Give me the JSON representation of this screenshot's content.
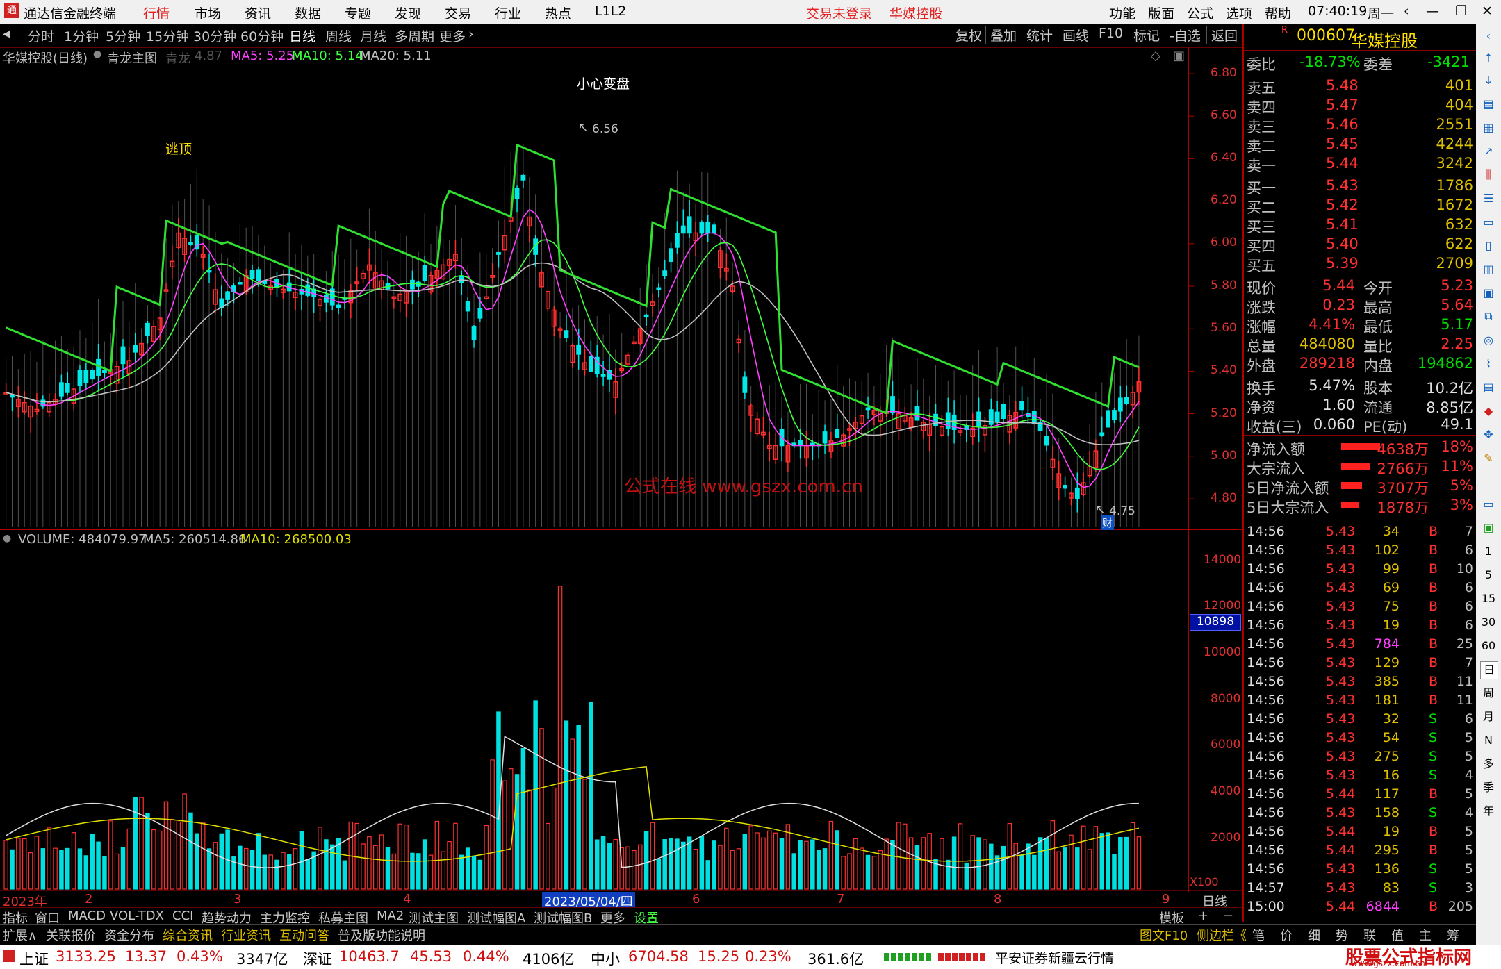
{
  "window": {
    "app_title": "通达信金融终端",
    "menus": [
      "行情",
      "市场",
      "资讯",
      "数据",
      "专题",
      "发现",
      "交易",
      "行业",
      "热点",
      "L1L2"
    ],
    "login_status": "交易未登录",
    "stock_name": "华媒控股",
    "right_menus": [
      "功能",
      "版面",
      "公式",
      "选项",
      "帮助"
    ],
    "time": "07:40:19",
    "weekday": "周一"
  },
  "periods": [
    "分时",
    "1分钟",
    "5分钟",
    "15分钟",
    "30分钟",
    "60分钟",
    "日线",
    "周线",
    "月线",
    "多周期",
    "更多"
  ],
  "selected_period": "日线",
  "toolbar_right": [
    "复权",
    "叠加",
    "统计",
    "画线",
    "F10",
    "标记",
    "-自选",
    "返回"
  ],
  "main_chart": {
    "legend_stock": "华媒控股(日线)",
    "legend_formula": "青龙主图",
    "qinglong_label": "青龙",
    "qinglong_value": "4.87",
    "ma5": "MA5: 5.25",
    "ma10": "MA10: 5.14",
    "ma20": "MA20: 5.11",
    "annotation_top": "小心变盘",
    "annotation_escape": "逃顶",
    "high_label": "6.56",
    "low_label": "4.75",
    "cai_badge": "财",
    "watermark": "公式在线  www.gszx.com.cn",
    "y_ticks": [
      "6.80",
      "6.60",
      "6.40",
      "6.20",
      "6.00",
      "5.80",
      "5.60",
      "5.40",
      "5.20",
      "5.00",
      "4.80"
    ]
  },
  "volume_chart": {
    "legend_volume": "VOLUME: 484079.97",
    "legend_ma5": "MA5: 260514.86",
    "legend_ma10": "MA10: 268500.03",
    "y_ticks": [
      "14000",
      "12000",
      "10000",
      "8000",
      "6000",
      "4000",
      "2000"
    ],
    "cursor_value": "10898",
    "unit": "X100"
  },
  "x_axis": {
    "labels": [
      "2023年",
      "2",
      "3",
      "4",
      "2023/05/04/四",
      "6",
      "7",
      "8",
      "9"
    ],
    "period_tag": "日线"
  },
  "indicator_tabs": [
    "指标",
    "窗口",
    "MACD",
    "VOL-TDX",
    "CCI",
    "趋势动力",
    "主力监控",
    "私募主图",
    "MA2",
    "测试主图",
    "测试幅图A",
    "测试幅图B",
    "更多",
    "设置"
  ],
  "indicator_right": [
    "模板",
    "+",
    "−"
  ],
  "bottom_tabs": [
    "扩展∧",
    "关联报价",
    "资金分布",
    "综合资讯",
    "行业资讯",
    "互动问答",
    "普及版功能说明"
  ],
  "bottom_right": [
    "图文F10",
    "侧边栏《",
    "笔",
    "价",
    "细",
    "势",
    "联",
    "值",
    "主",
    "筹"
  ],
  "status": {
    "sh_label": "上证",
    "sh_value": "3133.25",
    "sh_change": "13.37",
    "sh_pct": "0.43%",
    "sh_amount": "3347亿",
    "sz_label": "深证",
    "sz_value": "10463.7",
    "sz_change": "45.53",
    "sz_pct": "0.44%",
    "sz_amount": "4106亿",
    "zx_label": "中小",
    "zx_value": "6704.58",
    "zx_change": "15.25",
    "zx_pct": "0.23%",
    "zx_amount": "361.6亿",
    "broker": "平安证券新疆云行情",
    "site_logo": "股票公式指标网",
    "site_url": "www.gszx.com.cn"
  },
  "quote": {
    "r_mark": "R",
    "code": "000607",
    "name": "华媒控股",
    "weibi_label": "委比",
    "weibi": "-18.73%",
    "weicha_label": "委差",
    "weicha": "-3421",
    "asks": [
      {
        "label": "卖五",
        "price": "5.48",
        "vol": "401"
      },
      {
        "label": "卖四",
        "price": "5.47",
        "vol": "404"
      },
      {
        "label": "卖三",
        "price": "5.46",
        "vol": "2551"
      },
      {
        "label": "卖二",
        "price": "5.45",
        "vol": "4244"
      },
      {
        "label": "卖一",
        "price": "5.44",
        "vol": "3242"
      }
    ],
    "bids": [
      {
        "label": "买一",
        "price": "5.43",
        "vol": "1786"
      },
      {
        "label": "买二",
        "price": "5.42",
        "vol": "1672"
      },
      {
        "label": "买三",
        "price": "5.41",
        "vol": "632"
      },
      {
        "label": "买四",
        "price": "5.40",
        "vol": "622"
      },
      {
        "label": "买五",
        "price": "5.39",
        "vol": "2709"
      }
    ],
    "stats1": [
      {
        "l1": "现价",
        "v1": "5.44",
        "c1": "#ff3030",
        "l2": "今开",
        "v2": "5.23",
        "c2": "#ff3030"
      },
      {
        "l1": "涨跌",
        "v1": "0.23",
        "c1": "#ff3030",
        "l2": "最高",
        "v2": "5.64",
        "c2": "#ff3030"
      },
      {
        "l1": "涨幅",
        "v1": "4.41%",
        "c1": "#ff3030",
        "l2": "最低",
        "v2": "5.17",
        "c2": "#00e000"
      },
      {
        "l1": "总量",
        "v1": "484080",
        "c1": "#e0c000",
        "l2": "量比",
        "v2": "2.25",
        "c2": "#ff3030"
      },
      {
        "l1": "外盘",
        "v1": "289218",
        "c1": "#ff3030",
        "l2": "内盘",
        "v2": "194862",
        "c2": "#00e000"
      }
    ],
    "stats2": [
      {
        "l1": "换手",
        "v1": "5.47%",
        "l2": "股本",
        "v2": "10.2亿"
      },
      {
        "l1": "净资",
        "v1": "1.60",
        "l2": "流通",
        "v2": "8.85亿"
      },
      {
        "l1": "收益(三)",
        "v1": "0.060",
        "l2": "PE(动)",
        "v2": "49.1"
      }
    ],
    "flows": [
      {
        "label": "净流入额",
        "value": "4638万",
        "pct": "18%",
        "bar": 0.18
      },
      {
        "label": "大宗流入",
        "value": "2766万",
        "pct": "11%",
        "bar": 0.11
      },
      {
        "label": "5日净流入额",
        "value": "3707万",
        "pct": "5%",
        "bar": 0.05
      },
      {
        "label": "5日大宗流入",
        "value": "1878万",
        "pct": "3%",
        "bar": 0.03
      }
    ],
    "ticks": [
      [
        "14:56",
        "5.43",
        "34",
        "B",
        "7"
      ],
      [
        "14:56",
        "5.43",
        "102",
        "B",
        "6"
      ],
      [
        "14:56",
        "5.43",
        "99",
        "B",
        "10"
      ],
      [
        "14:56",
        "5.43",
        "69",
        "B",
        "6"
      ],
      [
        "14:56",
        "5.43",
        "75",
        "B",
        "6"
      ],
      [
        "14:56",
        "5.43",
        "19",
        "B",
        "6"
      ],
      [
        "14:56",
        "5.43",
        "784",
        "B",
        "25"
      ],
      [
        "14:56",
        "5.43",
        "129",
        "B",
        "7"
      ],
      [
        "14:56",
        "5.43",
        "385",
        "B",
        "11"
      ],
      [
        "14:56",
        "5.43",
        "181",
        "B",
        "11"
      ],
      [
        "14:56",
        "5.43",
        "32",
        "S",
        "6"
      ],
      [
        "14:56",
        "5.43",
        "54",
        "S",
        "5"
      ],
      [
        "14:56",
        "5.43",
        "275",
        "S",
        "5"
      ],
      [
        "14:56",
        "5.43",
        "16",
        "S",
        "4"
      ],
      [
        "14:56",
        "5.44",
        "117",
        "B",
        "5"
      ],
      [
        "14:56",
        "5.43",
        "158",
        "S",
        "4"
      ],
      [
        "14:56",
        "5.44",
        "19",
        "B",
        "5"
      ],
      [
        "14:56",
        "5.44",
        "295",
        "B",
        "5"
      ],
      [
        "14:56",
        "5.43",
        "136",
        "S",
        "5"
      ],
      [
        "14:57",
        "5.43",
        "83",
        "S",
        "3"
      ],
      [
        "15:00",
        "5.44",
        "6844",
        "B",
        "205"
      ]
    ]
  },
  "side_strip": [
    "日",
    "周",
    "月",
    "N",
    "多",
    "季",
    "年"
  ],
  "side_numbers": [
    "1",
    "5",
    "15",
    "30",
    "60"
  ],
  "colors": {
    "up": "#ff3030",
    "down": "#00e0e0",
    "ma5": "#ff40ff",
    "ma10": "#40ff40",
    "ma20": "#c0c0c0",
    "band": "#30e030"
  }
}
